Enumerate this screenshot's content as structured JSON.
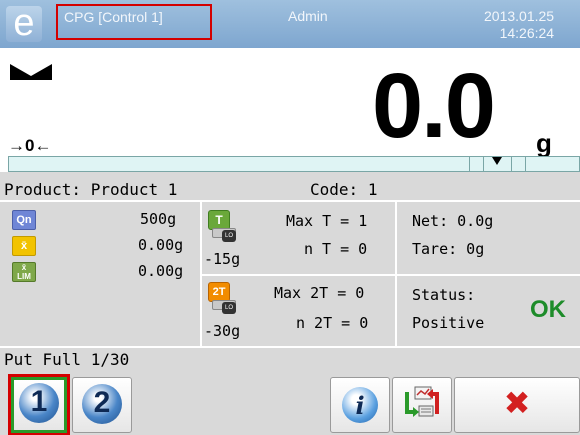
{
  "header": {
    "logo_glyph": "e",
    "mode": "CPG [Control 1]",
    "user": "Admin",
    "date": "2013.01.25",
    "time": "14:26:24"
  },
  "display": {
    "zero_indicator": "→0←",
    "weight": "0.0",
    "unit": "g"
  },
  "product_line": {
    "product_label": "Product:",
    "product_value": "Product 1",
    "code_label": "Code:",
    "code_value": "1"
  },
  "stats": {
    "qn_icon": "Qn",
    "qn_value": "500g",
    "mean_icon": "x̄",
    "mean_value": "0.00g",
    "lim_icon_top": "x̄",
    "lim_icon_bottom": "LIM",
    "lim_value": "0.00g"
  },
  "tolerances": {
    "t_icon": "T",
    "t_lo": "LO",
    "t_value": "-15g",
    "max_t": "Max T = 1",
    "n_t": "n T = 0",
    "t2_icon": "2T",
    "t2_lo": "LO",
    "t2_value": "-30g",
    "max_2t": "Max 2T = 0",
    "n_2t": "n 2T = 0"
  },
  "results": {
    "net": "Net: 0.0g",
    "tare": "Tare: 0g",
    "status_label": "Status:",
    "status_value": "Positive",
    "ok": "OK"
  },
  "progress_text": "Put Full 1/30",
  "toolbar": {
    "btn1": "1",
    "btn2": "2",
    "info": "i",
    "cancel": "✖"
  },
  "colors": {
    "header_bg": "#8fb1d6",
    "ok_green": "#1e8c2a",
    "highlight_red": "#d40000",
    "highlight_green": "#2a9a2a"
  }
}
